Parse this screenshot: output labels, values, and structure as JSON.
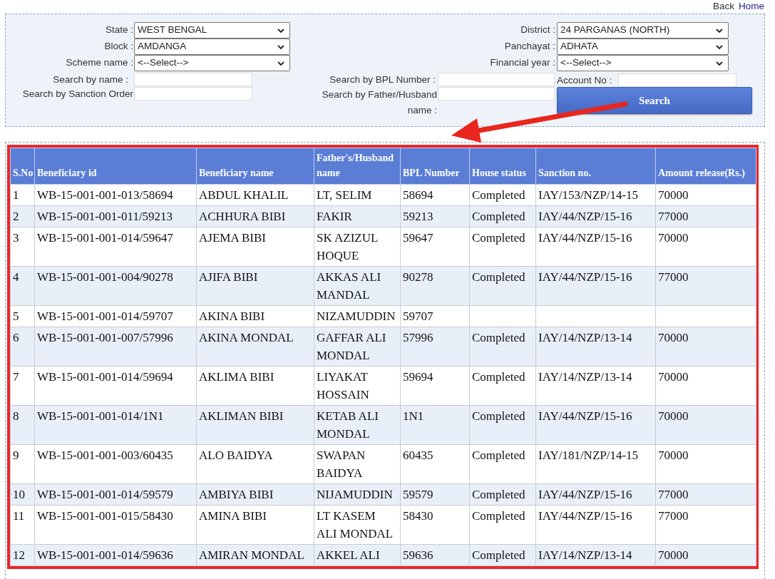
{
  "nav": {
    "back": "Back",
    "home": "Home"
  },
  "filters": {
    "left": [
      {
        "label": "State :",
        "value": "WEST BENGAL"
      },
      {
        "label": "Block :",
        "value": "AMDANGA"
      },
      {
        "label": "Scheme name :",
        "value": "<--Select-->"
      }
    ],
    "right": [
      {
        "label": "District :",
        "value": "24 PARGANAS (NORTH)"
      },
      {
        "label": "Panchayat :",
        "value": "ADHATA"
      },
      {
        "label": "Financial year :",
        "value": "<--Select-->"
      }
    ]
  },
  "search": {
    "name_label": "Search by name :",
    "sanction_order_label": "Search by Sanction Order",
    "bpl_label": "Search by BPL Number :",
    "father_husband_label": "Search by Father/Husband name :",
    "account_label": "Account No :",
    "button": "Search"
  },
  "table": {
    "columns": [
      "S.No",
      "Beneficiary id",
      "Beneficiary name",
      "Father's/Husband name",
      "BPL Number",
      "House status",
      "Sanction no.",
      "Amount release(Rs.)"
    ],
    "rows": [
      {
        "s_no": "1",
        "beneficiary_id": "WB-15-001-001-013/58694",
        "beneficiary_name": "ABDUL KHALIL",
        "father_husband_name": "LT, SELIM",
        "bpl_number": "58694",
        "house_status": "Completed",
        "sanction_no": "IAY/153/NZP/14-15",
        "amount_release": "70000"
      },
      {
        "s_no": "2",
        "beneficiary_id": "WB-15-001-001-011/59213",
        "beneficiary_name": "ACHHURA BIBI",
        "father_husband_name": "FAKIR",
        "bpl_number": "59213",
        "house_status": "Completed",
        "sanction_no": "IAY/44/NZP/15-16",
        "amount_release": "77000"
      },
      {
        "s_no": "3",
        "beneficiary_id": "WB-15-001-001-014/59647",
        "beneficiary_name": "AJEMA BIBI",
        "father_husband_name": "SK AZIZUL HOQUE",
        "bpl_number": "59647",
        "house_status": "Completed",
        "sanction_no": "IAY/44/NZP/15-16",
        "amount_release": "70000"
      },
      {
        "s_no": "4",
        "beneficiary_id": "WB-15-001-001-004/90278",
        "beneficiary_name": "AJIFA BIBI",
        "father_husband_name": "AKKAS ALI MANDAL",
        "bpl_number": "90278",
        "house_status": "Completed",
        "sanction_no": "IAY/44/NZP/15-16",
        "amount_release": "77000"
      },
      {
        "s_no": "5",
        "beneficiary_id": "WB-15-001-001-014/59707",
        "beneficiary_name": "AKINA BIBI",
        "father_husband_name": "NIZAMUDDIN",
        "bpl_number": "59707"
      },
      {
        "s_no": "6",
        "beneficiary_id": "WB-15-001-001-007/57996",
        "beneficiary_name": "AKINA MONDAL",
        "father_husband_name": "GAFFAR ALI MONDAL",
        "bpl_number": "57996",
        "house_status": "Completed",
        "sanction_no": "IAY/14/NZP/13-14",
        "amount_release": "70000"
      },
      {
        "s_no": "7",
        "beneficiary_id": "WB-15-001-001-014/59694",
        "beneficiary_name": "AKLIMA BIBI",
        "father_husband_name": "LIYAKAT HOSSAIN",
        "bpl_number": "59694",
        "house_status": "Completed",
        "sanction_no": "IAY/14/NZP/13-14",
        "amount_release": "70000"
      },
      {
        "s_no": "8",
        "beneficiary_id": "WB-15-001-001-014/1N1",
        "beneficiary_name": "AKLIMAN BIBI",
        "father_husband_name": "KETAB ALI MONDAL",
        "bpl_number": "1N1",
        "house_status": "Completed",
        "sanction_no": "IAY/44/NZP/15-16",
        "amount_release": "70000"
      },
      {
        "s_no": "9",
        "beneficiary_id": "WB-15-001-001-003/60435",
        "beneficiary_name": "ALO BAIDYA",
        "father_husband_name": "SWAPAN BAIDYA",
        "bpl_number": "60435",
        "house_status": "Completed",
        "sanction_no": "IAY/181/NZP/14-15",
        "amount_release": "70000"
      },
      {
        "s_no": "10",
        "beneficiary_id": "WB-15-001-001-014/59579",
        "beneficiary_name": "AMBIYA BIBI",
        "father_husband_name": "NIJAMUDDIN",
        "bpl_number": "59579",
        "house_status": "Completed",
        "sanction_no": "IAY/44/NZP/15-16",
        "amount_release": "77000"
      },
      {
        "s_no": "11",
        "beneficiary_id": "WB-15-001-001-015/58430",
        "beneficiary_name": "AMINA BIBI",
        "father_husband_name": "LT KASEM ALI MONDAL",
        "bpl_number": "58430",
        "house_status": "Completed",
        "sanction_no": "IAY/44/NZP/15-16",
        "amount_release": "77000"
      },
      {
        "s_no": "12",
        "beneficiary_id": "WB-15-001-001-014/59636",
        "beneficiary_name": "AMIRAN MONDAL",
        "father_husband_name": "AKKEL ALI",
        "bpl_number": "59636",
        "house_status": "Completed",
        "sanction_no": "IAY/14/NZP/13-14",
        "amount_release": "70000"
      }
    ]
  }
}
